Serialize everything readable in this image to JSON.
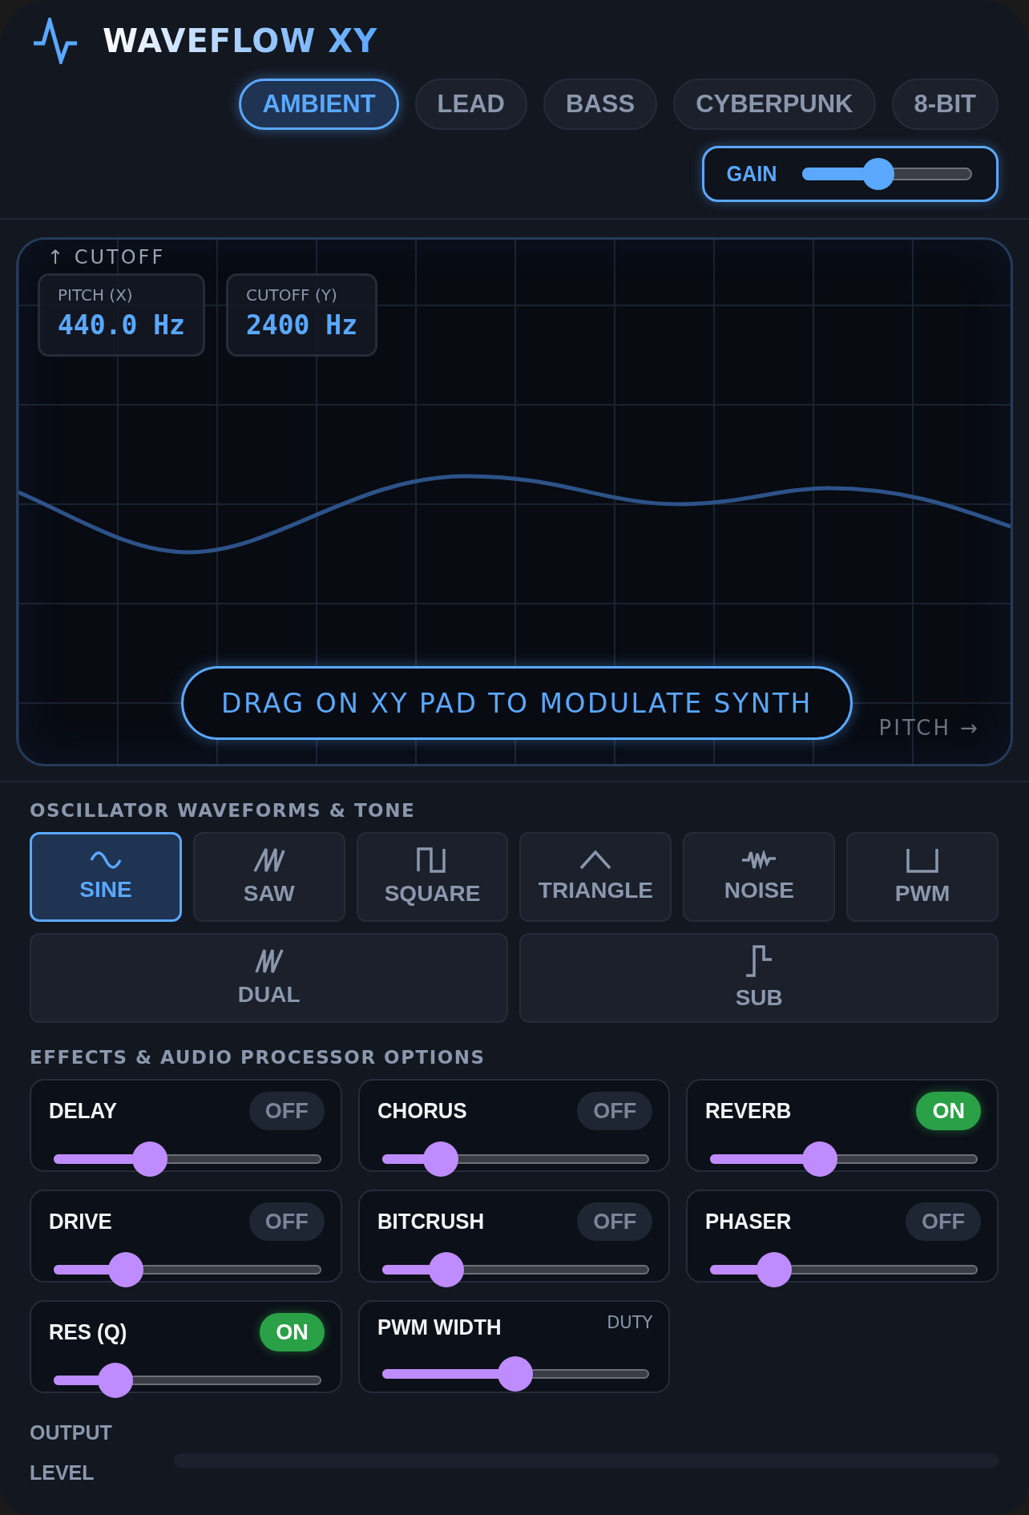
{
  "app": {
    "title": "WAVEFLOW XY"
  },
  "presets": [
    {
      "label": "AMBIENT",
      "selected": true
    },
    {
      "label": "LEAD",
      "selected": false
    },
    {
      "label": "BASS",
      "selected": false
    },
    {
      "label": "CYBERPUNK",
      "selected": false
    },
    {
      "label": "8-BIT",
      "selected": false
    }
  ],
  "gain": {
    "label": "GAIN",
    "level": 0.45
  },
  "xy_pad": {
    "y_axis_label": "↑ CUTOFF",
    "x_axis_label": "PITCH →",
    "hint": "DRAG ON XY PAD TO MODULATE SYNTH",
    "readouts": [
      {
        "label": "PITCH (X)",
        "value": "440.0 Hz"
      },
      {
        "label": "CUTOFF (Y)",
        "value": "2400 Hz"
      }
    ]
  },
  "oscillator": {
    "title": "OSCILLATOR WAVEFORMS & TONE",
    "waveforms": [
      {
        "label": "SINE",
        "selected": true
      },
      {
        "label": "SAW",
        "selected": false
      },
      {
        "label": "SQUARE",
        "selected": false
      },
      {
        "label": "TRIANGLE",
        "selected": false
      },
      {
        "label": "NOISE",
        "selected": false
      },
      {
        "label": "PWM",
        "selected": false
      },
      {
        "label": "DUAL",
        "selected": false
      },
      {
        "label": "SUB",
        "selected": false
      }
    ]
  },
  "effects": {
    "title": "EFFECTS & AUDIO PROCESSOR OPTIONS",
    "items": [
      {
        "name": "DELAY",
        "kind": "toggle",
        "status": "OFF",
        "on": false,
        "level": 0.36
      },
      {
        "name": "CHORUS",
        "kind": "toggle",
        "status": "OFF",
        "on": false,
        "level": 0.22
      },
      {
        "name": "REVERB",
        "kind": "toggle",
        "status": "ON",
        "on": true,
        "level": 0.41
      },
      {
        "name": "DRIVE",
        "kind": "toggle",
        "status": "OFF",
        "on": false,
        "level": 0.27
      },
      {
        "name": "BITCRUSH",
        "kind": "toggle",
        "status": "OFF",
        "on": false,
        "level": 0.24
      },
      {
        "name": "PHASER",
        "kind": "toggle",
        "status": "OFF",
        "on": false,
        "level": 0.24
      },
      {
        "name": "RES (Q)",
        "kind": "toggle",
        "status": "ON",
        "on": true,
        "level": 0.23
      },
      {
        "name": "PWM WIDTH",
        "kind": "caption",
        "status": "DUTY",
        "level": 0.5
      }
    ]
  },
  "output": {
    "label": "OUTPUT LEVEL"
  }
}
